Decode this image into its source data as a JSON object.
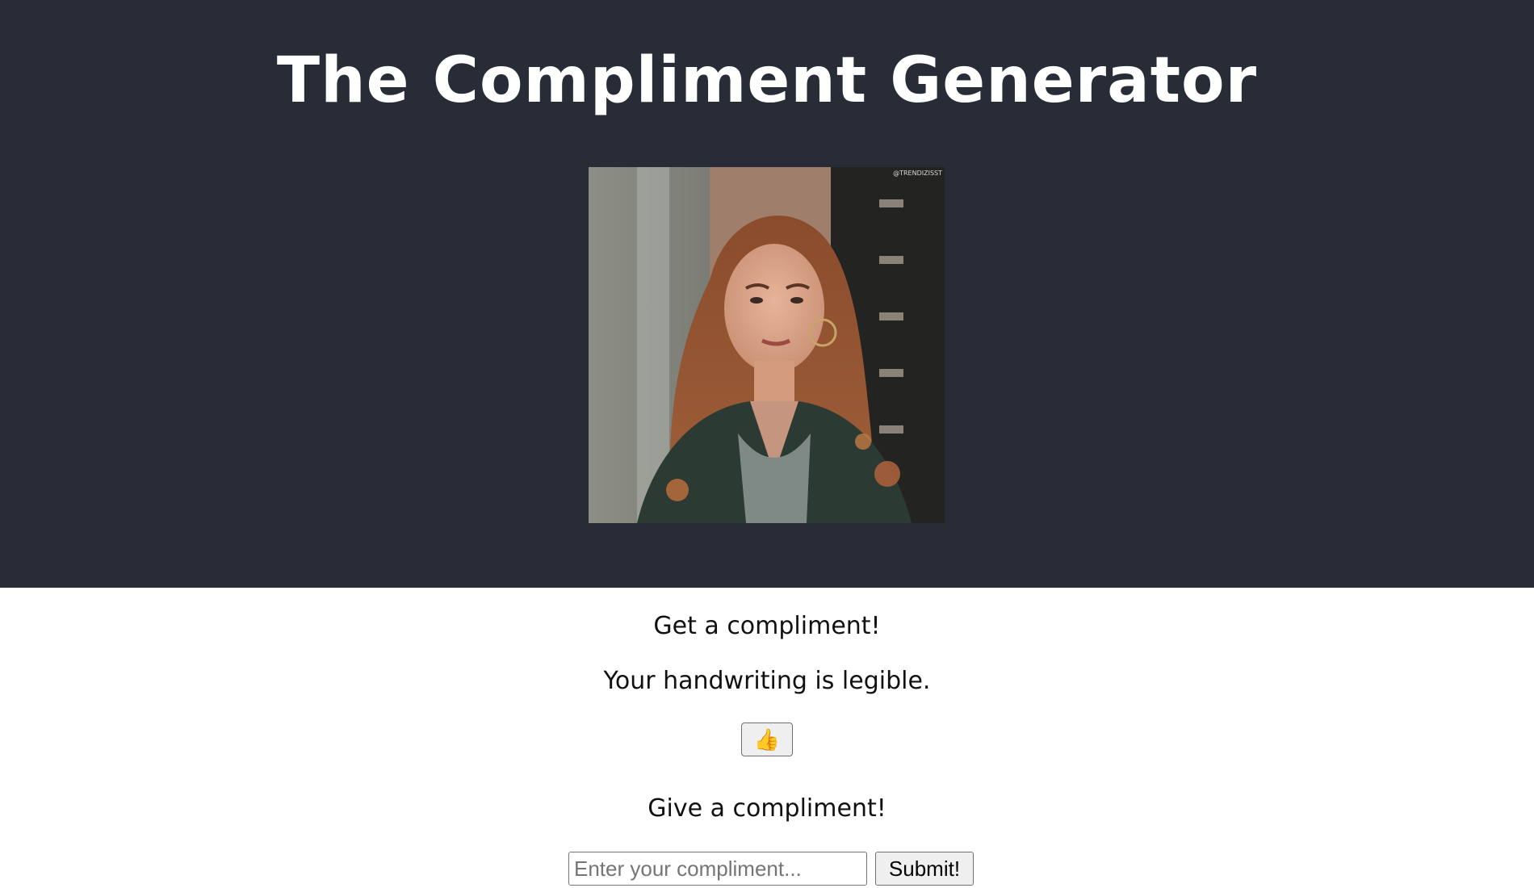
{
  "header": {
    "title": "The Compliment Generator",
    "background_color": "#282c36"
  },
  "hero_image": {
    "kind": "animated-gif",
    "watermark": "@TRENDIZISST"
  },
  "get_section": {
    "heading": "Get a compliment!",
    "compliment": "Your handwriting is legible.",
    "thumbs_up_label": "👍"
  },
  "give_section": {
    "heading": "Give a compliment!",
    "input_value": "",
    "input_placeholder": "Enter your compliment...",
    "submit_label": "Submit!"
  }
}
